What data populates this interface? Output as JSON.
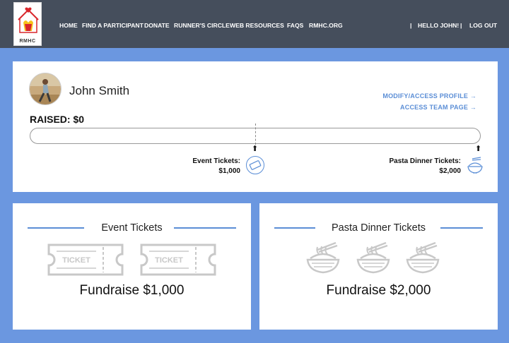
{
  "logo": {
    "text": "RMHC"
  },
  "nav": {
    "items": [
      "HOME",
      "FIND A PARTICIPANT",
      "DONATE",
      "RUNNER'S CIRCLE",
      "WEB RESOURCES",
      "FAQS",
      "RMHC.ORG"
    ],
    "greeting": "HELLO JOHN!",
    "logout": "LOG OUT",
    "separator": "|"
  },
  "profile": {
    "name": "John Smith",
    "raised_label": "RAISED: $0",
    "raised_value": 0,
    "progress_fraction": 0,
    "links": {
      "modify": "MODIFY/ACCESS PROFILE →",
      "team": "ACCESS TEAM PAGE →"
    },
    "milestones": [
      {
        "line1": "Event Tickets:",
        "line2": "$1,000",
        "icon": "ticket-icon"
      },
      {
        "line1": "Pasta Dinner Tickets:",
        "line2": "$2,000",
        "icon": "pasta-bowl-icon"
      }
    ]
  },
  "goals": [
    {
      "title": "Event Tickets",
      "amount": "Fundraise $1,000",
      "ticket_text": "TICKET"
    },
    {
      "title": "Pasta Dinner Tickets",
      "amount": "Fundraise $2,000"
    }
  ],
  "colors": {
    "nav_bg": "#454e5c",
    "page_bg": "#6b97e0",
    "accent": "#5b8ed6"
  }
}
